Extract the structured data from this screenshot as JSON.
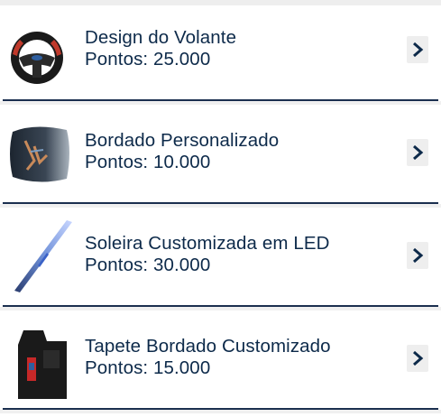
{
  "rewards": [
    {
      "title": "Design do Volante",
      "points": "Pontos: 25.000",
      "image": "steering-wheel"
    },
    {
      "title": "Bordado Personalizado",
      "points": "Pontos: 10.000",
      "image": "embroidered-seat"
    },
    {
      "title": "Soleira Customizada em LED",
      "points": "Pontos: 30.000",
      "image": "led-door-sill"
    },
    {
      "title": "Tapete Bordado Customizado",
      "points": "Pontos: 15.000",
      "image": "car-floor-mat"
    }
  ],
  "icons": {
    "arrow": "chevron-right-icon"
  },
  "colors": {
    "text": "#0d2a4a",
    "separator": "#1b2f4f",
    "arrow_bg": "#eeeeee"
  }
}
